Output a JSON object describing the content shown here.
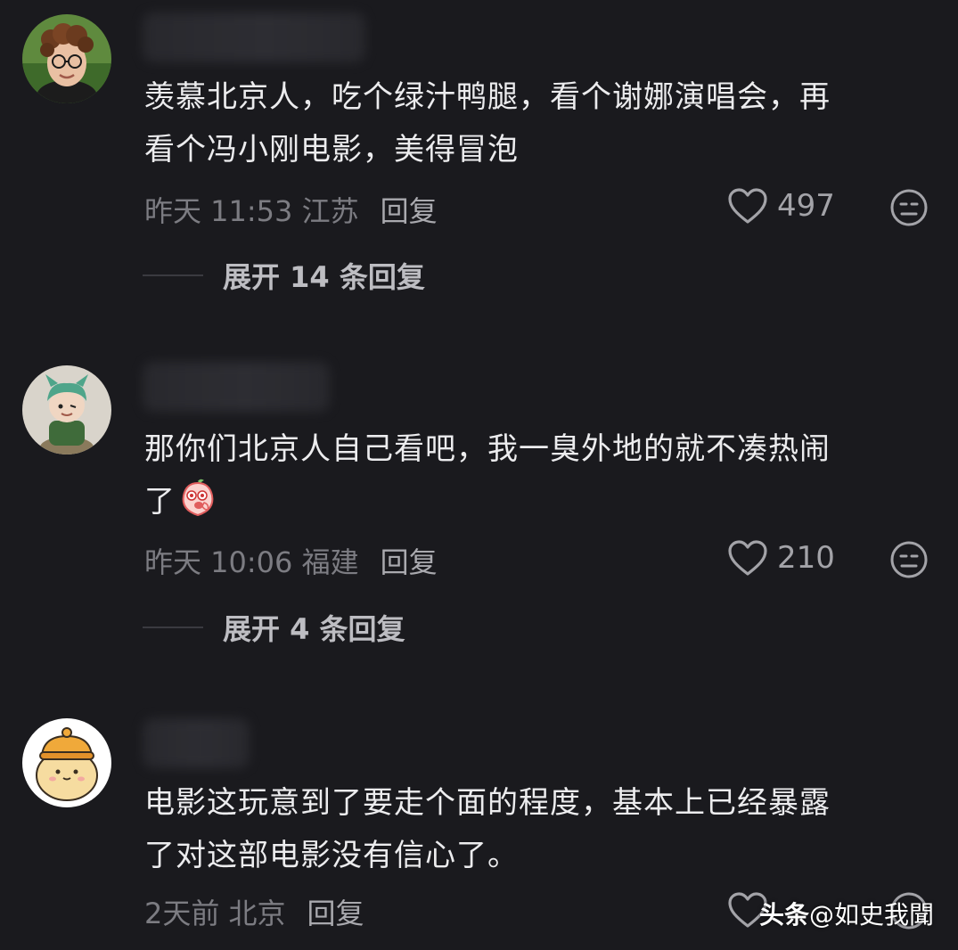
{
  "colors": {
    "background": "#1a1a1e",
    "text_primary": "#ececee",
    "text_meta": "#7c7c82",
    "icon": "#a3a3a8"
  },
  "comments": [
    {
      "text_line1": "羡慕北京人，吃个绿汁鸭腿，看个谢娜演唱会，再",
      "text_line2": "看个冯小刚电影，美得冒泡",
      "time": "昨天 11:53 江苏",
      "reply_label": "回复",
      "likes": "497",
      "expand_label": "展开 14 条回复",
      "avatar_icon": "avatar-curly-hair-man"
    },
    {
      "text_line1": "那你们北京人自己看吧，我一臭外地的就不凑热闹",
      "text_line2": "了",
      "emoji": "shy-peach-emoji",
      "time": "昨天 10:06 福建",
      "reply_label": "回复",
      "likes": "210",
      "expand_label": "展开 4 条回复",
      "avatar_icon": "avatar-green-hair-figurine"
    },
    {
      "text_line1": "电影这玩意到了要走个面的程度，基本上已经暴露",
      "text_line2": "了对这部电影没有信心了。",
      "time": "2天前 北京",
      "reply_label": "回复",
      "avatar_icon": "avatar-cartoon-bear"
    }
  ],
  "watermark": {
    "brand": "头条",
    "handle": "@如史我聞"
  }
}
